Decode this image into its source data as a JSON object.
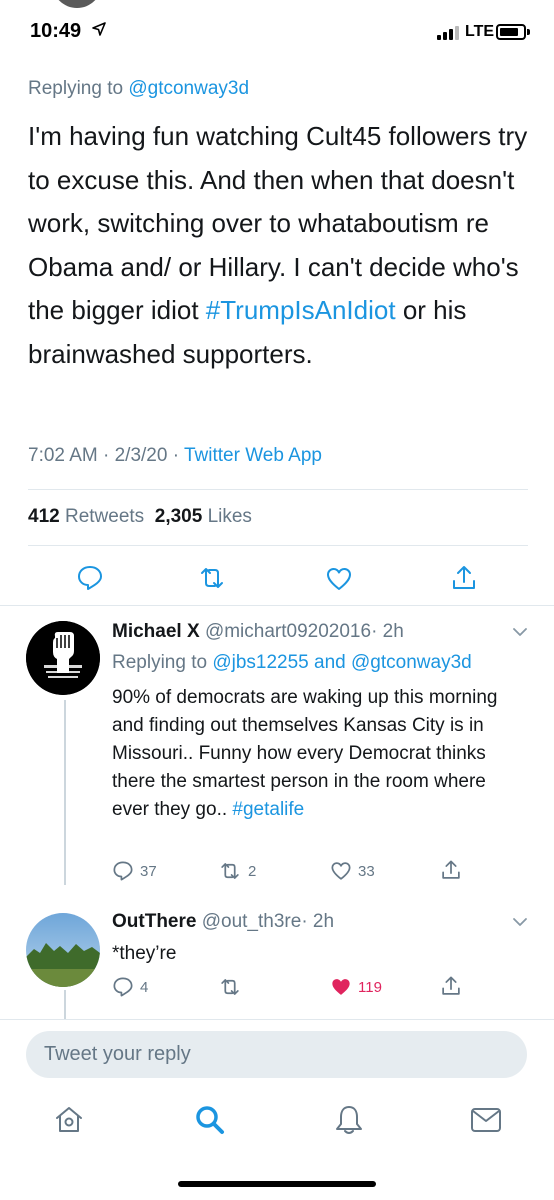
{
  "status_bar": {
    "time": "10:49",
    "network": "LTE"
  },
  "main_tweet": {
    "replying_prefix": "Replying to",
    "replying_handle": "@gtconway3d",
    "text_before": "I'm having fun watching Cult45 followers try to excuse this. And then when that doesn't work, switching over to whataboutism re Obama and/ or Hillary. I can't decide who's the bigger idiot",
    "hashtag": "#TrumpIsAnIdiot",
    "text_after": "or his brainwashed supporters.",
    "timestamp": "7:02 AM · 2/3/20 ·",
    "source": "Twitter Web App",
    "retweets_count": "412",
    "retweets_label": "Retweets",
    "likes_count": "2,305",
    "likes_label": "Likes"
  },
  "replies": [
    {
      "name": "Michael X",
      "handle": "@michart09202016",
      "time": "· 2h",
      "replying_prefix": "Replying to",
      "replying_handles": "@jbs12255 and @gtconway3d",
      "text": "90% of democrats are waking up this morning and finding out themselves Kansas City is in Missouri..  Funny how every Democrat thinks there the smartest person in the room where ever they go..",
      "hashtag": "#getalife",
      "replies": "37",
      "retweets": "2",
      "likes": "33"
    },
    {
      "name": "OutThere",
      "handle": "@out_th3re",
      "time": "· 2h",
      "text": "*they’re",
      "replies": "4",
      "likes": "119"
    }
  ],
  "reply_box": {
    "placeholder": "Tweet your reply"
  },
  "colors": {
    "accent": "#1b95e0",
    "like": "#e0245e",
    "muted": "#657786"
  }
}
